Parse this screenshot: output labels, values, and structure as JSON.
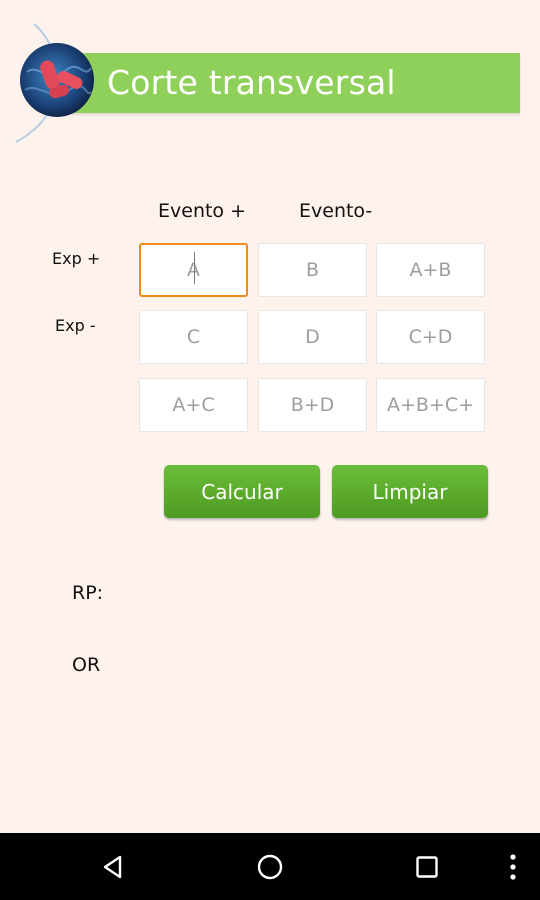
{
  "header": {
    "title": "Corte transversal",
    "logo_icon": "bacteria-logo-icon",
    "bar_color": "#8fd05a"
  },
  "table": {
    "col_headers": [
      "Evento +",
      "Evento-"
    ],
    "row_headers": [
      "Exp +",
      "Exp -"
    ],
    "cells": [
      {
        "placeholder": "A",
        "value": ""
      },
      {
        "placeholder": "B",
        "value": ""
      },
      {
        "placeholder": "A+B",
        "value": ""
      },
      {
        "placeholder": "C",
        "value": ""
      },
      {
        "placeholder": "D",
        "value": ""
      },
      {
        "placeholder": "C+D",
        "value": ""
      },
      {
        "placeholder": "A+C",
        "value": ""
      },
      {
        "placeholder": "B+D",
        "value": ""
      },
      {
        "placeholder": "A+B+C+",
        "value": ""
      }
    ],
    "focus_color": "#f08a1c"
  },
  "buttons": {
    "calculate_label": "Calcular",
    "clear_label": "Limpiar",
    "color": "#5aab2c"
  },
  "results": {
    "rp_label": "RP:",
    "or_label": "OR"
  },
  "navbar": {
    "back_icon": "back-triangle-icon",
    "home_icon": "home-circle-icon",
    "recent_icon": "recent-apps-square-icon",
    "menu_icon": "overflow-menu-icon"
  }
}
